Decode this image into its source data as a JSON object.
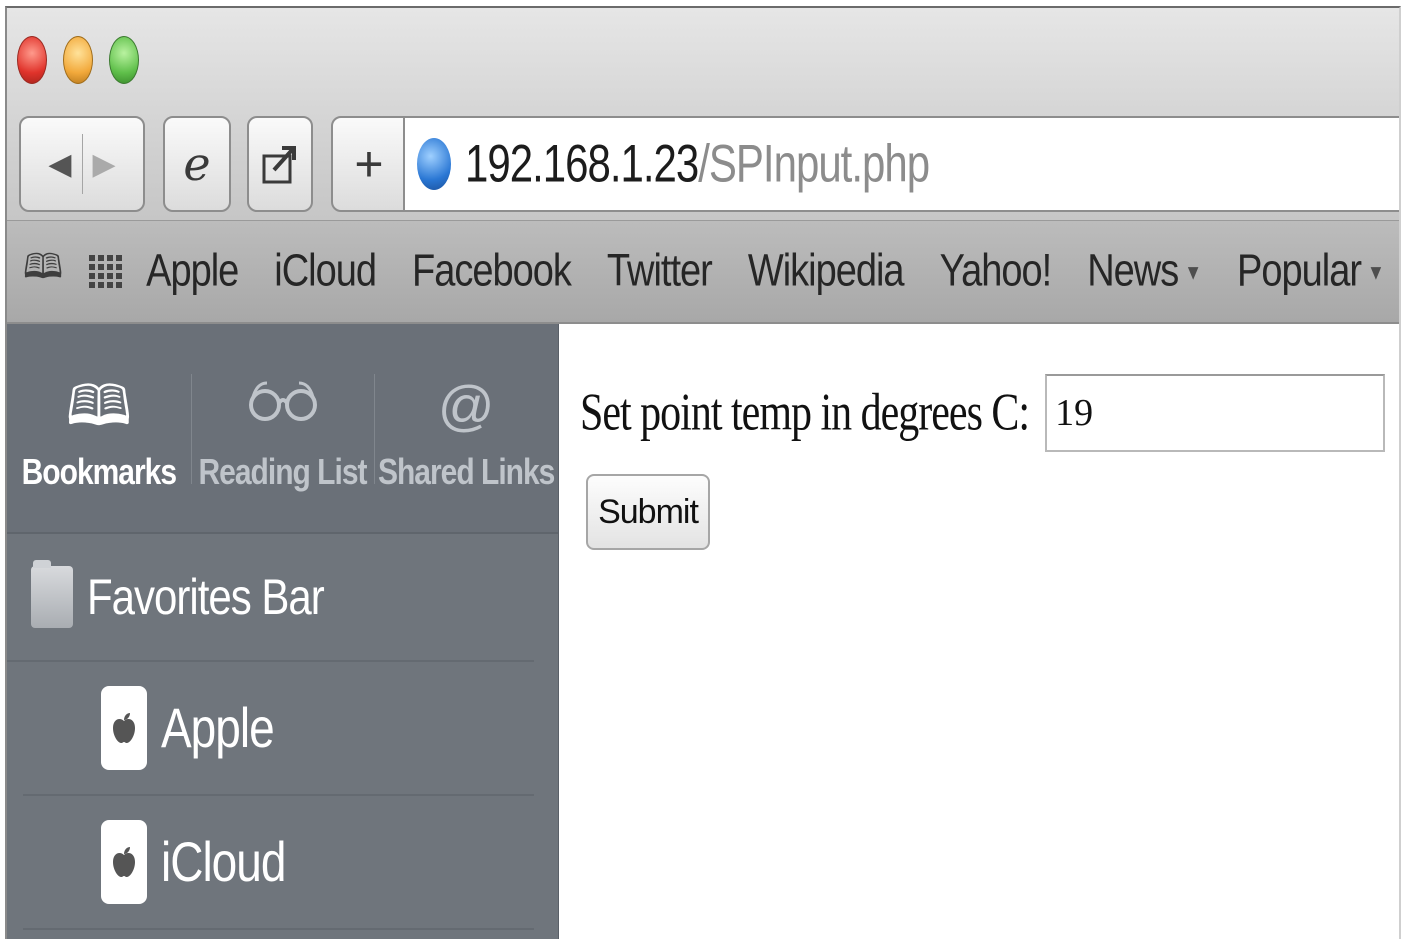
{
  "toolbar": {
    "back_icon": "back-arrow-icon",
    "forward_icon": "forward-arrow-icon",
    "ie_label": "e",
    "plus_label": "+"
  },
  "address_bar": {
    "host": "192.168.1.23",
    "path": "/SPInput.php"
  },
  "favorites_bar": {
    "items": [
      {
        "label": "Apple"
      },
      {
        "label": "iCloud"
      },
      {
        "label": "Facebook"
      },
      {
        "label": "Twitter"
      },
      {
        "label": "Wikipedia"
      },
      {
        "label": "Yahoo!"
      },
      {
        "label": "News",
        "has_menu": true
      },
      {
        "label": "Popular",
        "has_menu": true
      }
    ],
    "caret": "▼"
  },
  "sidebar": {
    "tabs": [
      {
        "label": "Bookmarks",
        "icon": "open-book-icon",
        "glyph": "🕮",
        "active": true
      },
      {
        "label": "Reading List",
        "icon": "glasses-icon",
        "glyph": "60",
        "active": false
      },
      {
        "label": "Shared Links",
        "icon": "at-sign-icon",
        "glyph": "@",
        "active": false
      }
    ],
    "folder": {
      "label": "Favorites Bar",
      "icon": "folder-icon"
    },
    "bookmarks": [
      {
        "label": "Apple",
        "icon": "apple-icon",
        "glyph": "●"
      },
      {
        "label": "iCloud",
        "icon": "apple-icon",
        "glyph": "●"
      }
    ]
  },
  "page": {
    "form_label": "Set point temp in degrees C:",
    "temp_value": "19",
    "submit_label": "Submit"
  },
  "colors": {
    "sidebar_bg": "#6f757c",
    "globe_blue": "#2a77d4"
  }
}
